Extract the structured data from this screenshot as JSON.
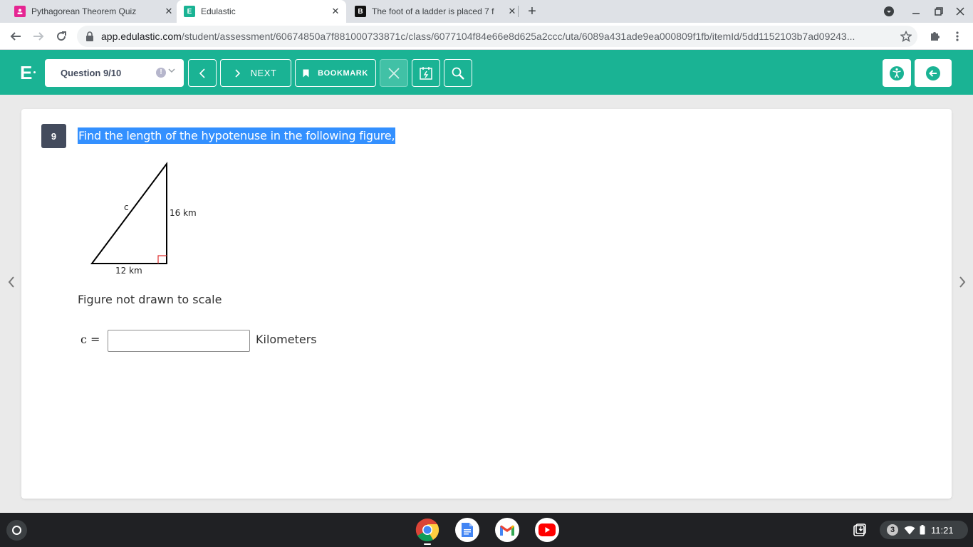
{
  "browser": {
    "tabs": [
      {
        "title": "Pythagorean Theorem Quiz",
        "favicon_color": "#e52592",
        "active": false
      },
      {
        "title": "Edulastic",
        "favicon_color": "#1ab394",
        "favicon_letter": "E",
        "active": true
      },
      {
        "title": "The foot of a ladder is placed 7 f",
        "favicon_color": "#111111",
        "favicon_letter": "B",
        "active": false
      }
    ],
    "url_host": "app.edulastic.com",
    "url_path": "/student/assessment/60674850a7f881000733871c/class/6077104f84e66e8d625a2ccc/uta/6089a431ade9ea000809f1fb/itemId/5dd1152103b7ad09243..."
  },
  "header": {
    "logo": "E",
    "question_selector": "Question 9/10",
    "next_label": "NEXT",
    "bookmark_label": "BOOKMARK",
    "accent_color": "#1ab394"
  },
  "question": {
    "number": "9",
    "stem": "Find the length of the hypotenuse in the following figure,",
    "figure": {
      "hypotenuse_label": "c",
      "vertical_label": "16 km",
      "horizontal_label": "12 km"
    },
    "note": "Figure not drawn to scale",
    "answer_label": "c =",
    "answer_value": "",
    "answer_unit": "Kilometers"
  },
  "shelf": {
    "apps": [
      "chrome-icon",
      "docs-icon",
      "gmail-icon",
      "youtube-icon"
    ],
    "notification_count": "3",
    "time": "11:21"
  }
}
